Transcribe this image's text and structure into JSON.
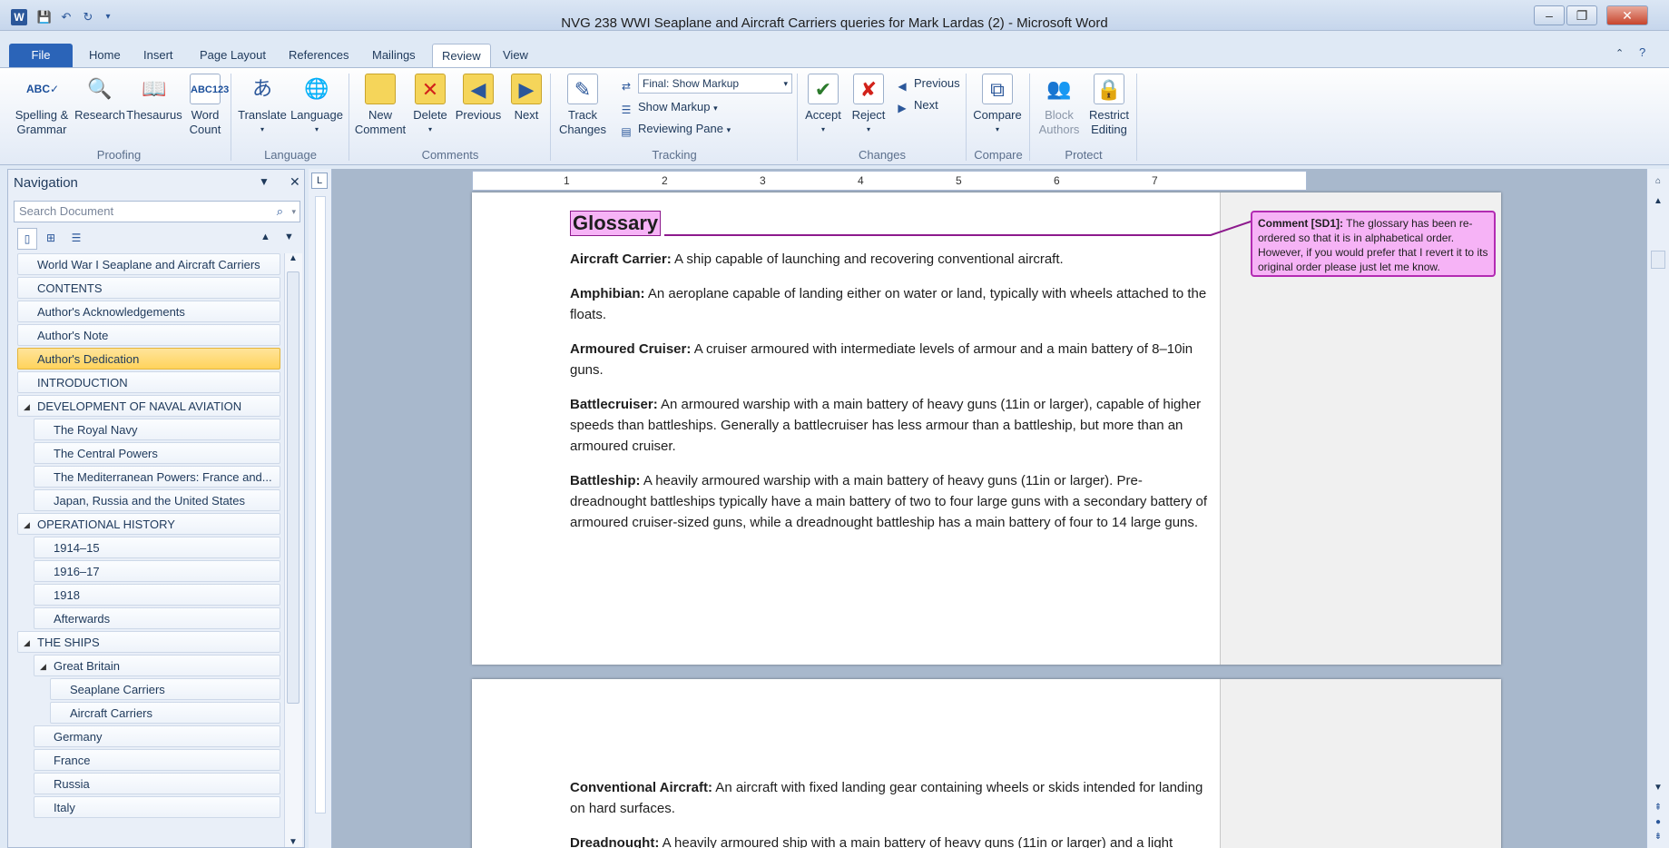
{
  "window": {
    "title": "NVG 238 WWI Seaplane and Aircraft Carriers queries for Mark Lardas (2)  -  Microsoft Word",
    "app_icon": "W"
  },
  "qat": [
    "save-icon",
    "undo-icon",
    "redo-icon",
    "customize-icon"
  ],
  "tabs": [
    "File",
    "Home",
    "Insert",
    "Page Layout",
    "References",
    "Mailings",
    "Review",
    "View"
  ],
  "active_tab": "Review",
  "ribbon": {
    "proofing": {
      "label": "Proofing",
      "spelling": "Spelling &\nGrammar",
      "research": "Research",
      "thesaurus": "Thesaurus",
      "word_count": "Word\nCount"
    },
    "language": {
      "label": "Language",
      "translate": "Translate",
      "language": "Language"
    },
    "comments": {
      "label": "Comments",
      "new": "New\nComment",
      "delete": "Delete",
      "previous": "Previous",
      "next": "Next"
    },
    "tracking": {
      "label": "Tracking",
      "track": "Track\nChanges",
      "markup_select": "Final: Show Markup",
      "show_markup": "Show Markup",
      "reviewing_pane": "Reviewing Pane"
    },
    "changes": {
      "label": "Changes",
      "accept": "Accept",
      "reject": "Reject",
      "previous": "Previous",
      "next": "Next"
    },
    "compare": {
      "label": "Compare",
      "compare": "Compare"
    },
    "protect": {
      "label": "Protect",
      "block": "Block\nAuthors",
      "restrict": "Restrict\nEditing"
    }
  },
  "navigation": {
    "title": "Navigation",
    "search_placeholder": "Search Document",
    "items": [
      {
        "label": "World War I Seaplane and Aircraft Carriers",
        "level": 0
      },
      {
        "label": "CONTENTS",
        "level": 0
      },
      {
        "label": "Author's Acknowledgements",
        "level": 0
      },
      {
        "label": "Author's Note",
        "level": 0
      },
      {
        "label": "Author's Dedication",
        "level": 0,
        "selected": true
      },
      {
        "label": "INTRODUCTION",
        "level": 0
      },
      {
        "label": "DEVELOPMENT OF NAVAL AVIATION",
        "level": 0,
        "expanded": true
      },
      {
        "label": "The Royal Navy",
        "level": 1
      },
      {
        "label": "The Central Powers",
        "level": 1
      },
      {
        "label": "The Mediterranean Powers: France and...",
        "level": 1
      },
      {
        "label": "Japan, Russia and the United States",
        "level": 1
      },
      {
        "label": "OPERATIONAL HISTORY",
        "level": 0,
        "expanded": true
      },
      {
        "label": "1914–15",
        "level": 1
      },
      {
        "label": "1916–17",
        "level": 1
      },
      {
        "label": "1918",
        "level": 1
      },
      {
        "label": "Afterwards",
        "level": 1
      },
      {
        "label": "THE SHIPS",
        "level": 0,
        "expanded": true
      },
      {
        "label": "Great Britain",
        "level": 1,
        "expanded": true
      },
      {
        "label": "Seaplane Carriers",
        "level": 2
      },
      {
        "label": "Aircraft Carriers",
        "level": 2
      },
      {
        "label": "Germany",
        "level": 1
      },
      {
        "label": "France",
        "level": 1
      },
      {
        "label": "Russia",
        "level": 1
      },
      {
        "label": "Italy",
        "level": 1
      }
    ]
  },
  "ruler_numbers": [
    "1",
    "2",
    "3",
    "4",
    "5",
    "6",
    "7"
  ],
  "document": {
    "heading": "Glossary",
    "page1": [
      {
        "term": "Aircraft Carrier:",
        "text": " A ship capable of launching and recovering conventional aircraft."
      },
      {
        "term": "Amphibian:",
        "text": " An aeroplane capable of landing either on water or land, typically with wheels attached to the floats."
      },
      {
        "term": "Armoured Cruiser:",
        "text": " A cruiser armoured with intermediate levels of armour and a main battery of 8–10in guns."
      },
      {
        "term": "Battlecruiser:",
        "text": " An armoured warship with a main battery of heavy guns (11in or larger), capable of higher speeds than battleships. Generally a battlecruiser has less armour than a battleship, but more than an armoured cruiser."
      },
      {
        "term": "Battleship:",
        "text": " A heavily armoured warship with a main battery of heavy guns (11in or larger). Pre-dreadnought battleships typically have a main battery of two to four large guns with a secondary battery of armoured cruiser-sized guns, while a dreadnought battleship has a main battery of four to 14 large guns."
      }
    ],
    "page2": [
      {
        "term": "Conventional Aircraft:",
        "text": " An aircraft with fixed landing gear containing wheels or skids intended for landing on hard surfaces."
      },
      {
        "term": "Dreadnought:",
        "text": " A heavily armoured ship with a main battery of heavy guns (11in or larger) and a light"
      }
    ]
  },
  "comment": {
    "label": "Comment [SD1]:",
    "text": " The glossary has been re-ordered so that it is in alphabetical order. However, if you would prefer that I revert it to its original order please just let me know."
  }
}
